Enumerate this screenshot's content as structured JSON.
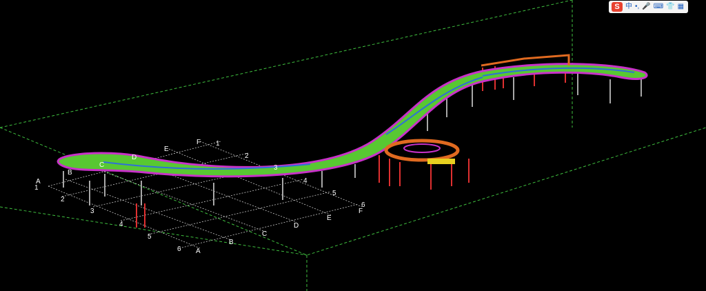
{
  "ime_toolbar": {
    "logo": "S",
    "mode": "中",
    "punct": "•,",
    "mic_icon": "mic-icon",
    "keyboard_icon": "keyboard-icon",
    "skin_icon": "skin-icon",
    "grid_icon": "toolbox-icon"
  },
  "grid_labels": {
    "front_numbers": [
      "1",
      "2",
      "3",
      "4",
      "5",
      "6"
    ],
    "front_letters": [
      "A",
      "B",
      "C",
      "D",
      "E",
      "F"
    ],
    "back_letters": [
      "B",
      "C",
      "D",
      "E",
      "F"
    ],
    "back_numbers": [
      "1",
      "2",
      "3",
      "4",
      "5",
      "6"
    ],
    "corner_letter": "A"
  },
  "colors": {
    "dashed_boundary": "#3fbf3f",
    "grid": "#c8c8c8",
    "deck_green": "#58c832",
    "edge_magenta": "#c832c8",
    "cross_blue": "#2f6fd8",
    "support_red": "#e03030",
    "support_orange": "#e06a20",
    "column_gray": "#a8a8a8"
  }
}
